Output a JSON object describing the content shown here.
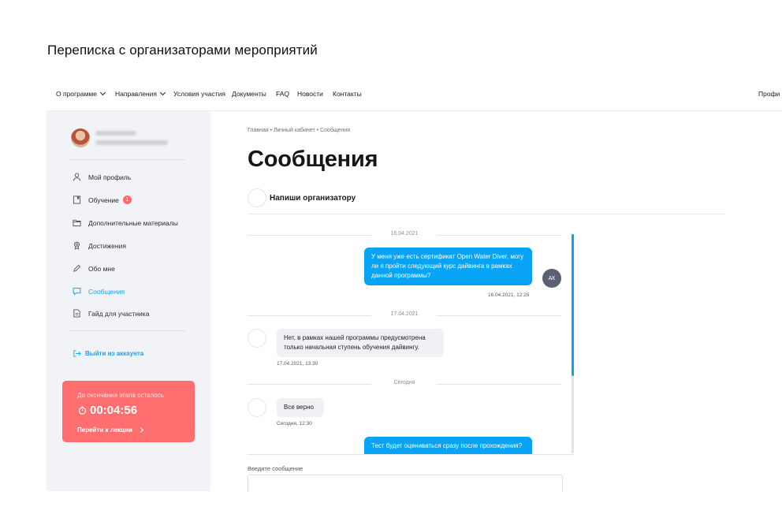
{
  "caption": "Переписка с организаторами мероприятий",
  "topnav": {
    "items": [
      {
        "label": "О программе",
        "has_dropdown": true
      },
      {
        "label": "Направления",
        "has_dropdown": true
      },
      {
        "label": "Условия участия",
        "has_dropdown": false
      },
      {
        "label": "Документы",
        "has_dropdown": false
      },
      {
        "label": "FAQ",
        "has_dropdown": false
      },
      {
        "label": "Новости",
        "has_dropdown": false
      },
      {
        "label": "Контакты",
        "has_dropdown": false
      }
    ],
    "profile_label": "Профи"
  },
  "sidebar": {
    "menu": [
      {
        "label": "Мой профиль",
        "icon": "user-icon",
        "active": false
      },
      {
        "label": "Обучение",
        "icon": "book-icon",
        "active": false,
        "badge": "1"
      },
      {
        "label": "Дополнительные материалы",
        "icon": "folder-icon",
        "active": false
      },
      {
        "label": "Достижения",
        "icon": "medal-icon",
        "active": false
      },
      {
        "label": "Обо мне",
        "icon": "pencil-icon",
        "active": false
      },
      {
        "label": "Сообщения",
        "icon": "chat-icon",
        "active": true
      },
      {
        "label": "Гайд для участника",
        "icon": "document-icon",
        "active": false
      }
    ],
    "logout_label": "Выйти из аккаунта",
    "timer": {
      "label": "До окончания этапа осталось",
      "time": "00:04:56",
      "link": "Перейти к лекции"
    }
  },
  "main": {
    "breadcrumb": "Главная  •  Личный кабинет  •  Сообщения",
    "title": "Сообщения",
    "organizer_label": "Напиши организатору",
    "thread": [
      {
        "date_separator": "16.04.2021"
      },
      {
        "direction": "out",
        "text": "У меня уже есть сертификат Open Water Diver, могу ли я пройти следующий курс дайвинга в рамках данной программы?",
        "time": "16.04.2021, 12:25",
        "avatar": "АК"
      },
      {
        "date_separator": "17.04.2021"
      },
      {
        "direction": "in",
        "text": "Нет, в рамках нашей программы предусмотрена только начальная ступень обучения дайвингу.",
        "time": "17.04.2021, 13:30"
      },
      {
        "date_separator": "Сегодня"
      },
      {
        "direction": "in",
        "text": "Все верно",
        "time": "Сегодня, 12:30"
      },
      {
        "direction": "out",
        "text": "Тест будет оцениваться сразу после прохождения?",
        "time": ""
      }
    ],
    "composer": {
      "label": "Введите сообщение",
      "value": "",
      "placeholder": ""
    }
  },
  "colors": {
    "accent": "#08a3f5",
    "timer_card": "#ff6f6f",
    "sidebar_bg": "#f2f3f7",
    "badge": "#ff6a6a"
  }
}
